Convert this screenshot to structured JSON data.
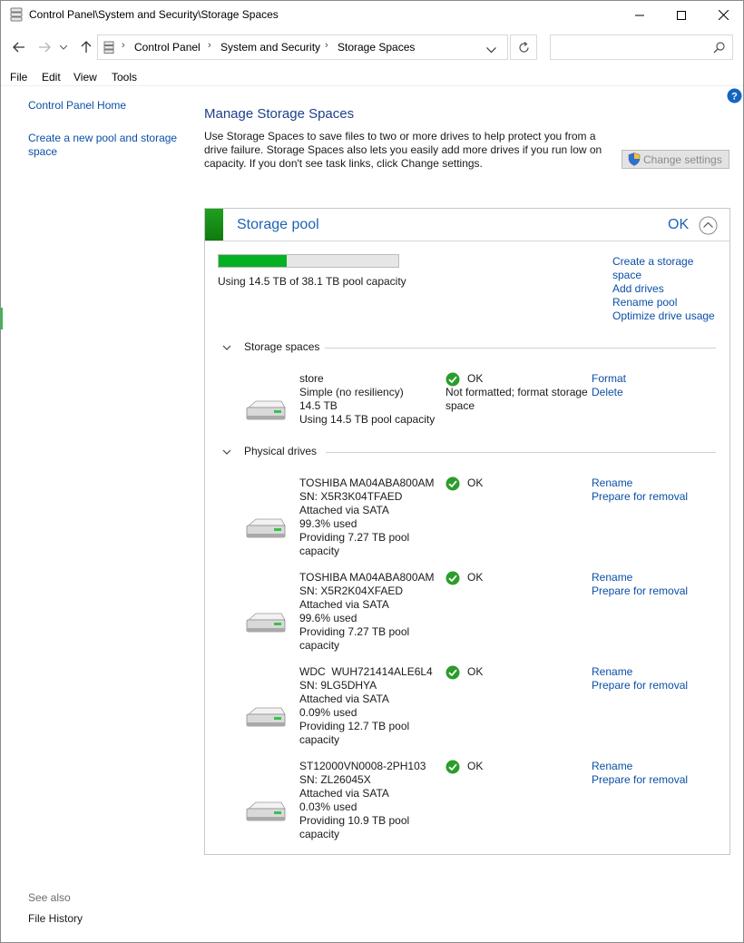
{
  "window": {
    "title": "Control Panel\\System and Security\\Storage Spaces",
    "minimize": "—",
    "maximize": "☐",
    "close": "✕"
  },
  "address": {
    "crumbs": [
      "Control Panel",
      "System and Security",
      "Storage Spaces"
    ],
    "search_placeholder": ""
  },
  "menu": [
    "File",
    "Edit",
    "View",
    "Tools"
  ],
  "sidebar": {
    "home": "Control Panel Home",
    "create_pool_line1": "Create a new pool and storage",
    "create_pool_line2": "space",
    "see_also": "See also",
    "file_history": "File History"
  },
  "main": {
    "heading": "Manage Storage Spaces",
    "intro_1": "Use Storage Spaces to save files to two or more drives to help protect you from a",
    "intro_2": "drive failure. Storage Spaces also lets you easily add more drives if you run low on",
    "intro_3": "capacity. If you don't see task links, click Change settings.",
    "change_settings": "Change settings"
  },
  "pool": {
    "title": "Storage pool",
    "status": "OK",
    "usage_text": "Using 14.5 TB of 38.1 TB pool capacity",
    "used_fraction": 0.38,
    "links": {
      "create_line1": "Create a storage",
      "create_line2": "space",
      "add_drives": "Add drives",
      "rename_pool": "Rename pool",
      "optimize": "Optimize drive usage"
    },
    "spaces_label": "Storage spaces",
    "drives_label": "Physical drives",
    "space": {
      "name": "store",
      "resiliency": "Simple (no resiliency)",
      "size": "14.5 TB",
      "using": "Using 14.5 TB pool capacity",
      "status": "OK",
      "note": "Not formatted; format storage space",
      "action_1": "Format",
      "action_2": "Delete"
    },
    "drives": [
      {
        "model": "TOSHIBA MA04ABA800AM",
        "sn": "SN: X5R3K04TFAED",
        "attach": "Attached via SATA",
        "used": "99.3% used",
        "prov_1": "Providing 7.27 TB pool",
        "prov_2": "capacity",
        "status": "OK",
        "action_1": "Rename",
        "action_2": "Prepare for removal"
      },
      {
        "model": "TOSHIBA MA04ABA800AM",
        "sn": "SN: X5R2K04XFAED",
        "attach": "Attached via SATA",
        "used": "99.6% used",
        "prov_1": "Providing 7.27 TB pool",
        "prov_2": "capacity",
        "status": "OK",
        "action_1": "Rename",
        "action_2": "Prepare for removal"
      },
      {
        "model": "WDC  WUH721414ALE6L4",
        "sn": "SN: 9LG5DHYA",
        "attach": "Attached via SATA",
        "used": "0.09% used",
        "prov_1": "Providing 12.7 TB pool",
        "prov_2": "capacity",
        "status": "OK",
        "action_1": "Rename",
        "action_2": "Prepare for removal"
      },
      {
        "model": "ST12000VN0008-2PH103",
        "sn": "SN: ZL26045X",
        "attach": "Attached via SATA",
        "used": "0.03% used",
        "prov_1": "Providing 10.9 TB pool",
        "prov_2": "capacity",
        "status": "OK",
        "action_1": "Rename",
        "action_2": "Prepare for removal"
      }
    ]
  },
  "colors": {
    "link": "#0b4fa6",
    "heading": "#1e3f8a",
    "pool_accent": "#1fa01f",
    "bar_fill": "#06b025",
    "ok_green": "#2a9d2a"
  },
  "icons": [
    "storage-spaces-icon",
    "back-arrow-icon",
    "forward-arrow-icon",
    "recent-dropdown-icon",
    "up-arrow-icon",
    "refresh-icon",
    "search-icon",
    "help-icon",
    "shield-icon",
    "collapse-chevron-icon",
    "drive-icon",
    "ok-check-icon"
  ]
}
